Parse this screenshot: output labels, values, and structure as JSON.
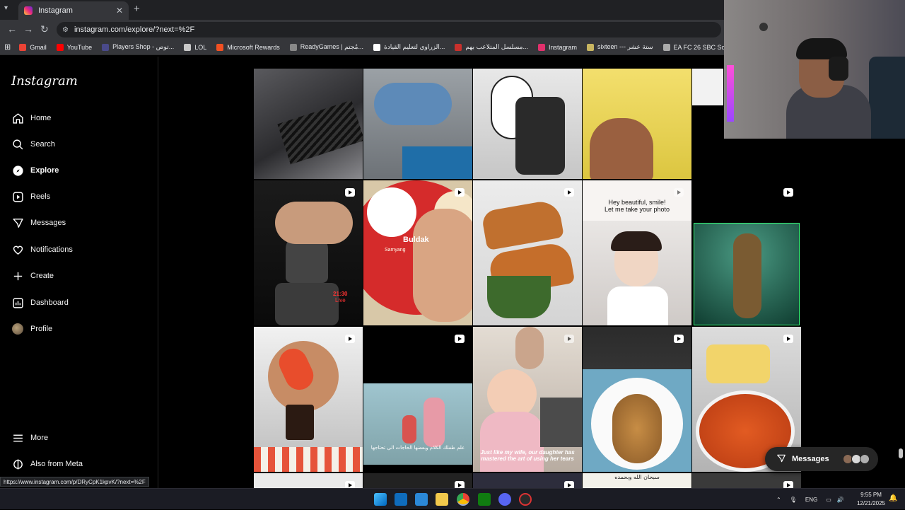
{
  "browser": {
    "tab_title": "Instagram",
    "tab_close": "✕",
    "new_tab": "+",
    "url": "instagram.com/explore/?next=%2F",
    "status_url": "https://www.instagram.com/p/DRyCpK1kpvK/?next=%2F",
    "bookmarks": [
      {
        "label": "Gmail",
        "color": "#ea4335"
      },
      {
        "label": "YouTube",
        "color": "#ff0000"
      },
      {
        "label": "Players Shop - توص...",
        "color": "#4a4a8a"
      },
      {
        "label": "LOL",
        "color": "#c9c9c9"
      },
      {
        "label": "Microsoft Rewards",
        "color": "#f25022"
      },
      {
        "label": "ReadyGames | مُجتم...",
        "color": "#888888"
      },
      {
        "label": "الزراوي لتعليم القيادة...",
        "color": "#ffffff"
      },
      {
        "label": "مسلسل المتلاعب بهم...",
        "color": "#c9302c"
      },
      {
        "label": "Instagram",
        "color": "#e1306c"
      },
      {
        "label": "sixteen --- ستة عشر",
        "color": "#c8b560"
      },
      {
        "label": "EA FC 26 SBC Soluti...",
        "color": "#aaaaaa"
      }
    ]
  },
  "sidebar": {
    "logo": "Instagram",
    "items": [
      {
        "label": "Home",
        "icon": "home-icon"
      },
      {
        "label": "Search",
        "icon": "search-icon"
      },
      {
        "label": "Explore",
        "icon": "explore-icon",
        "active": true
      },
      {
        "label": "Reels",
        "icon": "reels-icon"
      },
      {
        "label": "Messages",
        "icon": "messages-icon"
      },
      {
        "label": "Notifications",
        "icon": "heart-icon"
      },
      {
        "label": "Create",
        "icon": "plus-icon"
      },
      {
        "label": "Dashboard",
        "icon": "dashboard-icon"
      },
      {
        "label": "Profile",
        "icon": "avatar"
      }
    ],
    "more": "More",
    "meta": "Also from Meta"
  },
  "grid": {
    "captions": {
      "buldak": "Buldak",
      "samyang": "Samyang",
      "live_time": "21:30",
      "live": "Live",
      "smile": "Hey beautiful, smile!\nLet me take your photo",
      "wife": "Just like my wife, our daughter has mastered the art of using her tears",
      "arabic_video": "علم طفلك الكلام وبعضها الحاجات الى تحتاجها",
      "bottom_arabic": "سبحان الله وبحمده"
    }
  },
  "messages_pill": {
    "label": "Messages"
  },
  "taskbar": {
    "lang": "ENG",
    "time": "9:55 PM",
    "date": "12/21/2025"
  }
}
